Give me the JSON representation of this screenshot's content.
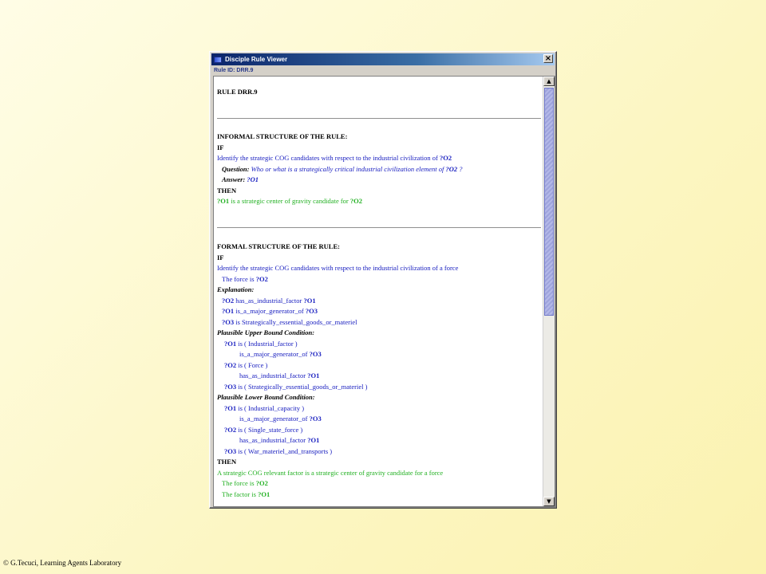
{
  "window": {
    "title": "Disciple Rule Viewer",
    "close_symbol": "×",
    "rule_id_label": "Rule ID: DRR.9"
  },
  "rule": {
    "header": "RULE DRR.9",
    "informal": {
      "heading": "INFORMAL STRUCTURE OF THE RULE:",
      "if_kw": "IF",
      "task_text": "Identify the strategic COG candidates with respect to the industrial civilization of ",
      "task_var": "?O2",
      "question_label": "Question:",
      "question_text": " Who or what is a strategically critical industrial civilization element of ",
      "question_var": "?O2",
      "question_end": " ?",
      "answer_label": "Answer:",
      "answer_var": " ?O1",
      "then_kw": "THEN",
      "conclusion_var": "?O1",
      "conclusion_text": " is a strategic center of gravity candidate for ",
      "conclusion_var2": "?O2"
    },
    "formal": {
      "heading": "FORMAL STRUCTURE OF THE RULE:",
      "if_kw": "IF",
      "task_text": "Identify the strategic COG candidates with respect to the industrial civilization of a force",
      "force_text": "The force is ",
      "force_var": "?O2",
      "explanation_label": "Explanation:",
      "explanation": [
        {
          "a": "?O2",
          "b": " has_as_industrial_factor ",
          "c": "?O1"
        },
        {
          "a": "?O1",
          "b": " is_a_major_generator_of ",
          "c": "?O3"
        },
        {
          "a": "?O3",
          "b": " is Strategically_essential_goods_or_materiel",
          "c": ""
        }
      ],
      "upper_label": "Plausible Upper Bound Condition:",
      "upper": [
        {
          "a": "?O1",
          "b": " is ( Industrial_factor )",
          "c": "",
          "indent": false
        },
        {
          "a": "",
          "b": "is_a_major_generator_of ",
          "c": "?O3",
          "indent": true
        },
        {
          "a": "?O2",
          "b": " is ( Force )",
          "c": "",
          "indent": false
        },
        {
          "a": "",
          "b": "has_as_industrial_factor ",
          "c": "?O1",
          "indent": true
        },
        {
          "a": "?O3",
          "b": " is ( Strategically_essential_goods_or_materiel )",
          "c": "",
          "indent": false
        }
      ],
      "lower_label": "Plausible Lower Bound Condition:",
      "lower": [
        {
          "a": "?O1",
          "b": " is ( Industrial_capacity )",
          "c": "",
          "indent": false
        },
        {
          "a": "",
          "b": "is_a_major_generator_of ",
          "c": "?O3",
          "indent": true
        },
        {
          "a": "?O2",
          "b": " is ( Single_state_force )",
          "c": "",
          "indent": false
        },
        {
          "a": "",
          "b": "has_as_industrial_factor ",
          "c": "?O1",
          "indent": true
        },
        {
          "a": "?O3",
          "b": " is ( War_materiel_and_transports )",
          "c": "",
          "indent": false
        }
      ],
      "then_kw": "THEN",
      "conclusion_text": "A strategic COG relevant factor is a strategic center of gravity candidate for a force",
      "conc_force_text": "The force is ",
      "conc_force_var": "?O2",
      "conc_factor_text": "The factor is ",
      "conc_factor_var": "?O1"
    }
  },
  "scrollbar": {
    "up_arrow": "▲",
    "down_arrow": "▼"
  },
  "footer": {
    "copyright": "© G.Tecuci, Learning Agents Laboratory"
  }
}
